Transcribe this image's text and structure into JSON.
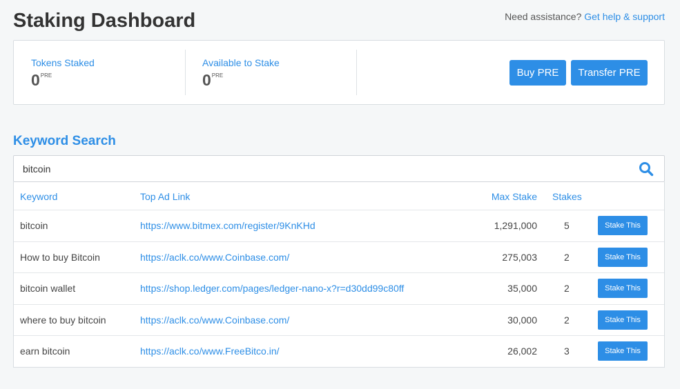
{
  "header": {
    "title": "Staking Dashboard",
    "help_prefix": "Need assistance?",
    "help_link": "Get help & support"
  },
  "stats": {
    "tokens_staked_label": "Tokens Staked",
    "tokens_staked_value": "0",
    "tokens_staked_unit": "PRE",
    "available_label": "Available to Stake",
    "available_value": "0",
    "available_unit": "PRE",
    "buy_label": "Buy PRE",
    "transfer_label": "Transfer PRE"
  },
  "search": {
    "section_title": "Keyword Search",
    "value": "bitcoin",
    "icon": "search-icon"
  },
  "table": {
    "headers": {
      "keyword": "Keyword",
      "top_ad_link": "Top Ad Link",
      "max_stake": "Max Stake",
      "stakes": "Stakes"
    },
    "rows": [
      {
        "keyword": "bitcoin",
        "link": "https://www.bitmex.com/register/9KnKHd",
        "max_stake": "1,291,000",
        "stakes": "5",
        "action": "Stake This"
      },
      {
        "keyword": "How to buy Bitcoin",
        "link": "https://aclk.co/www.Coinbase.com/",
        "max_stake": "275,003",
        "stakes": "2",
        "action": "Stake This"
      },
      {
        "keyword": "bitcoin wallet",
        "link": "https://shop.ledger.com/pages/ledger-nano-x?r=d30dd99c80ff",
        "max_stake": "35,000",
        "stakes": "2",
        "action": "Stake This"
      },
      {
        "keyword": "where to buy bitcoin",
        "link": "https://aclk.co/www.Coinbase.com/",
        "max_stake": "30,000",
        "stakes": "2",
        "action": "Stake This"
      },
      {
        "keyword": "earn bitcoin",
        "link": "https://aclk.co/www.FreeBitco.in/",
        "max_stake": "26,002",
        "stakes": "3",
        "action": "Stake This"
      }
    ]
  },
  "colors": {
    "accent": "#2d8ee6",
    "background": "#f5f7f8",
    "card": "#ffffff",
    "border": "#d8dde1"
  }
}
